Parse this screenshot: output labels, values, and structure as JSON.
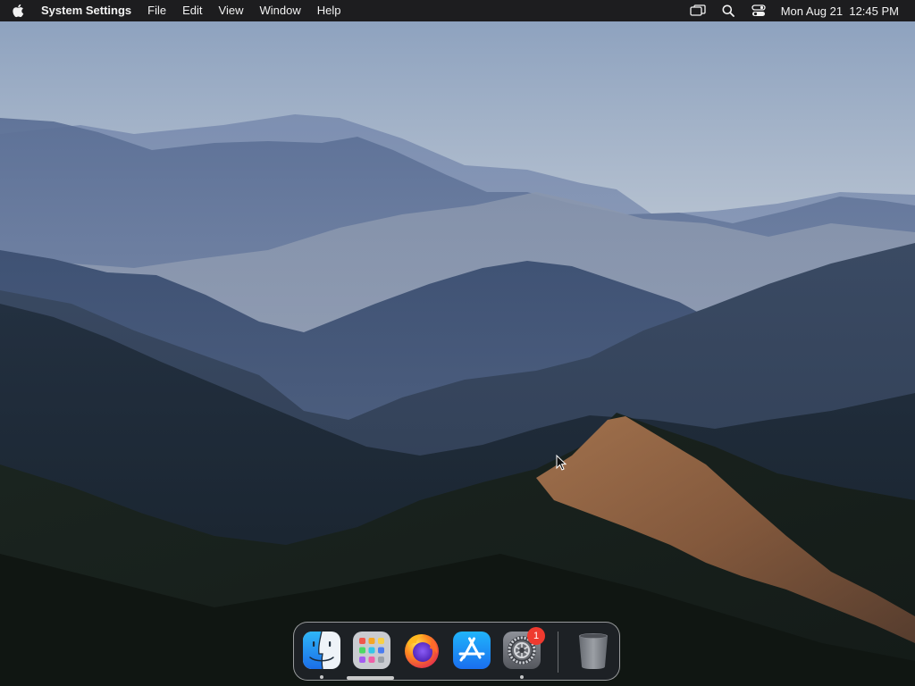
{
  "menubar": {
    "app_name": "System Settings",
    "menus": [
      "File",
      "Edit",
      "View",
      "Window",
      "Help"
    ],
    "status_icons": [
      "screen-mirroring-icon",
      "search-icon",
      "control-center-icon"
    ],
    "clock": {
      "date": "Mon Aug 21",
      "time": "12:45 PM"
    }
  },
  "dock": {
    "apps": [
      {
        "name": "Finder",
        "icon": "finder-icon",
        "running": true
      },
      {
        "name": "Launchpad",
        "icon": "launchpad-icon",
        "running": false
      },
      {
        "name": "Firefox",
        "icon": "firefox-icon",
        "running": false
      },
      {
        "name": "App Store",
        "icon": "app-store-icon",
        "running": false
      },
      {
        "name": "System Settings",
        "icon": "system-settings-icon",
        "running": true,
        "badge": "1"
      }
    ],
    "trash": {
      "name": "Trash",
      "icon": "trash-icon"
    }
  },
  "colors": {
    "menubar_bg": "#1d1d1f",
    "badge": "#ef3a2f",
    "app_store_blue": "#1a8cf5"
  }
}
